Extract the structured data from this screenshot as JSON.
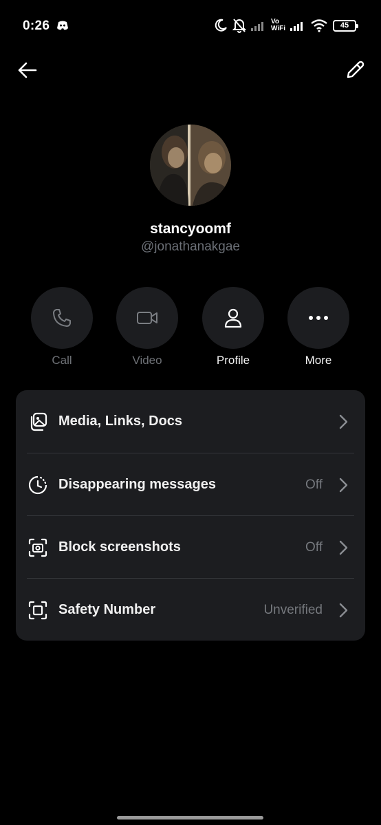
{
  "status_bar": {
    "time": "0:26",
    "vowifi_top": "Vo",
    "vowifi_bottom": "WiFi",
    "battery": "45"
  },
  "profile": {
    "display_name": "stancyoomf",
    "handle": "@jonathanakgae"
  },
  "actions": [
    {
      "label": "Call",
      "icon": "phone-icon",
      "enabled": false
    },
    {
      "label": "Video",
      "icon": "video-camera-icon",
      "enabled": false
    },
    {
      "label": "Profile",
      "icon": "person-icon",
      "enabled": true
    },
    {
      "label": "More",
      "icon": "more-dots-icon",
      "enabled": true
    }
  ],
  "settings": [
    {
      "label": "Media, Links, Docs",
      "value": "",
      "icon": "media-gallery-icon"
    },
    {
      "label": "Disappearing messages",
      "value": "Off",
      "icon": "timer-icon"
    },
    {
      "label": "Block screenshots",
      "value": "Off",
      "icon": "screenshot-camera-icon"
    },
    {
      "label": "Safety Number",
      "value": "Unverified",
      "icon": "safety-scan-icon"
    }
  ],
  "colors": {
    "background": "#000000",
    "surface": "#1c1d20",
    "muted_text": "#6f7277"
  }
}
